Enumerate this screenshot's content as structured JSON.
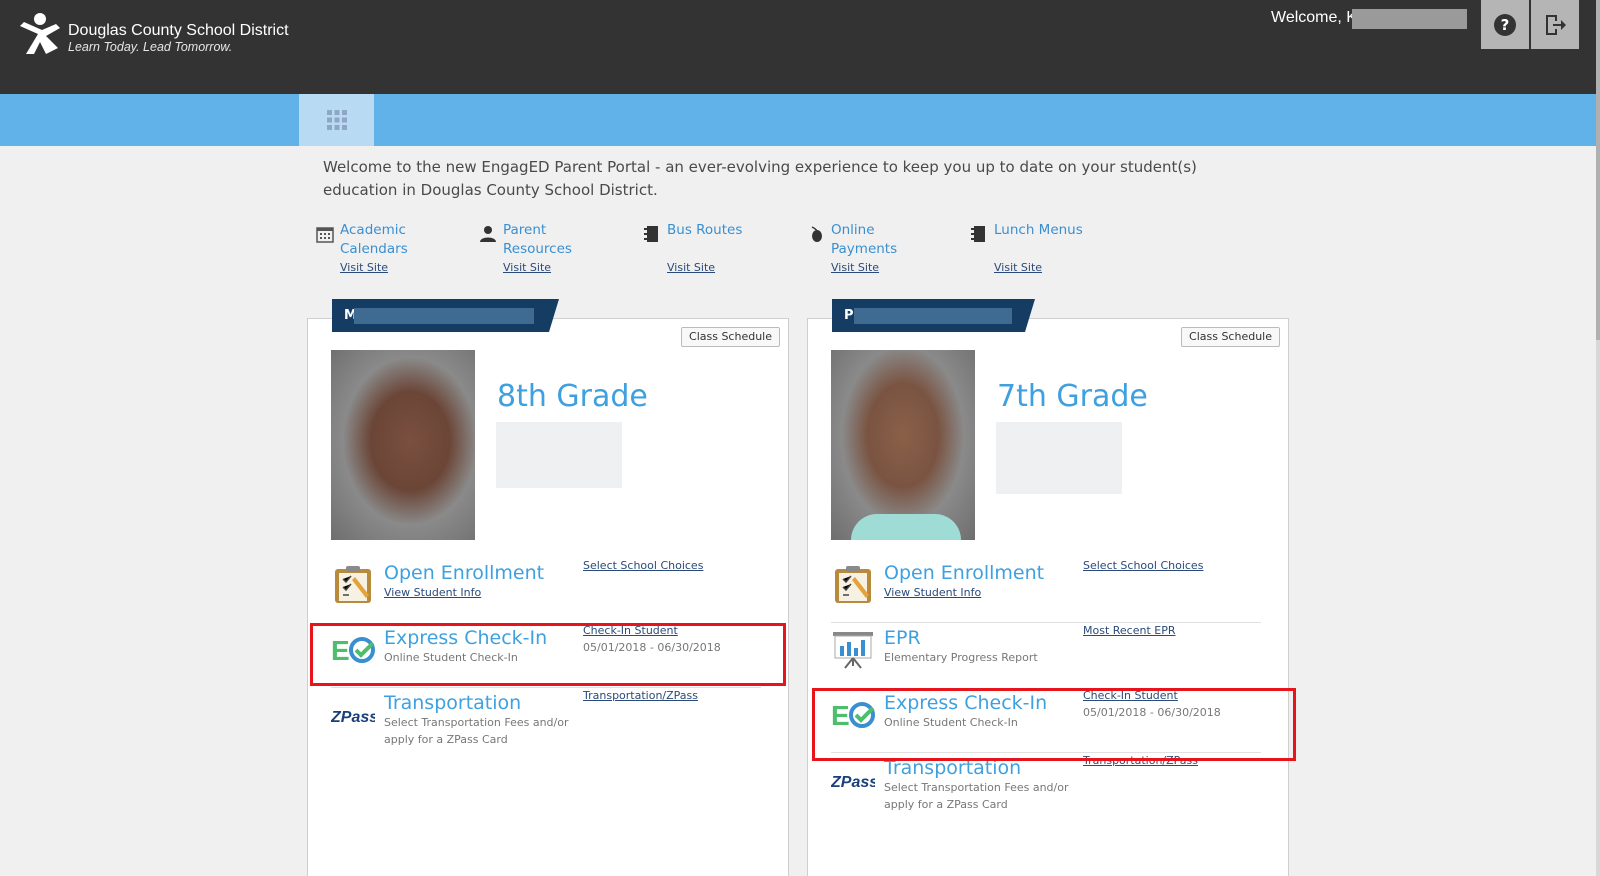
{
  "header": {
    "district_name": "Douglas County School District",
    "tagline": "Learn Today. Lead Tomorrow.",
    "welcome": "Welcome, K"
  },
  "intro_text": "Welcome to the new EngagED Parent Portal - an ever-evolving experience to keep you up to date on your student(s) education in Douglas County School District.",
  "quick_links": [
    {
      "label": "Academic Calendars",
      "visit": "Visit Site",
      "icon": "calendar-icon"
    },
    {
      "label": "Parent Resources",
      "visit": "Visit Site",
      "icon": "person-icon"
    },
    {
      "label": "Bus Routes",
      "visit": "Visit Site",
      "icon": "notebook-icon"
    },
    {
      "label": "Online Payments",
      "visit": "Visit Site",
      "icon": "mouse-icon"
    },
    {
      "label": "Lunch Menus",
      "visit": "Visit Site",
      "icon": "notebook-icon"
    }
  ],
  "students": [
    {
      "initial": "M",
      "class_schedule": "Class Schedule",
      "grade": "8th Grade",
      "open_enrollment": {
        "title": "Open Enrollment",
        "sub": "View Student Info",
        "link": "Select School Choices"
      },
      "express_checkin": {
        "title": "Express Check-In",
        "sub": "Online Student Check-In",
        "link": "Check-In Student",
        "dates": "05/01/2018 - 06/30/2018"
      },
      "transportation": {
        "title": "Transportation",
        "sub": "Select Transportation Fees and/or apply for a ZPass Card",
        "link": "Transportation/ZPass"
      }
    },
    {
      "initial": "P",
      "class_schedule": "Class Schedule",
      "grade": "7th Grade",
      "open_enrollment": {
        "title": "Open Enrollment",
        "sub": "View Student Info",
        "link": "Select School Choices"
      },
      "epr": {
        "title": "EPR",
        "sub": "Elementary Progress Report",
        "link": "Most Recent EPR"
      },
      "express_checkin": {
        "title": "Express Check-In",
        "sub": "Online Student Check-In",
        "link": "Check-In Student",
        "dates": "05/01/2018 - 06/30/2018"
      },
      "transportation": {
        "title": "Transportation",
        "sub": "Select Transportation Fees and/or apply for a ZPass Card",
        "link": "Transportation/ZPass"
      }
    }
  ],
  "colors": {
    "header": "#333333",
    "bluebar": "#62b2ea",
    "accent": "#3fa0e0",
    "highlight": "#e8141c",
    "tab": "#153d63"
  }
}
